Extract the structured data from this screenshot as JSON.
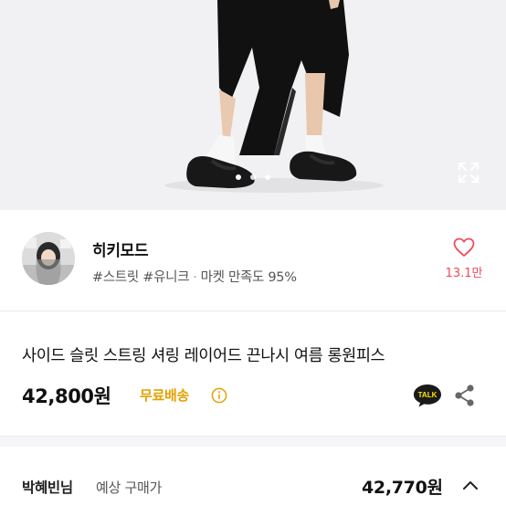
{
  "hero": {
    "image_description_icon": "product-photo",
    "page_indicator": {
      "count": 3,
      "active": 1
    },
    "expand_icon": "expand-icon"
  },
  "shop": {
    "name": "히키모드",
    "tags": "#스트릿 #유니크",
    "separator": "·",
    "satisfaction": "마켓 만족도 95%",
    "likes": "13.1만",
    "like_icon": "heart-icon"
  },
  "product": {
    "title": "사이드 슬릿 스트링 셔링 레이어드 끈나시 여름 롱원피스",
    "price": "42,800원",
    "shipping": "무료배송",
    "talk_label": "TALK",
    "share_icon": "share-icon"
  },
  "expected_buyer": {
    "name": "박혜빈님",
    "label": "예상 구매가",
    "price": "42,770원"
  },
  "colors": {
    "accent_shipping": "#e2a100",
    "like_red": "#ef4b5b",
    "kakao_yellow": "#fee500"
  }
}
